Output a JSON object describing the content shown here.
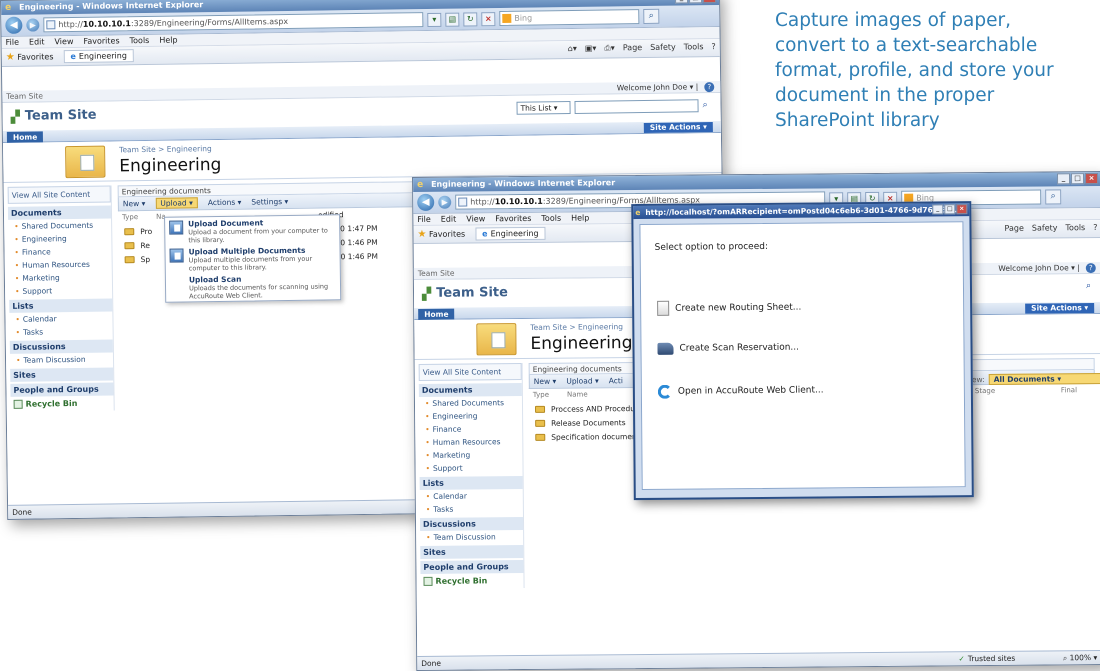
{
  "caption": {
    "lines": [
      "Capture images of paper,",
      "convert to a text-searchable",
      "format, profile, and store your",
      "document in the proper",
      "SharePoint library"
    ]
  },
  "browser": {
    "title": "Engineering - Windows Internet Explorer",
    "address_prefix": "http://",
    "address_host": "10.10.10.1",
    "address_rest": ":3289/Engineering/Forms/AllItems.aspx",
    "search_placeholder": "Bing",
    "menu": [
      "File",
      "Edit",
      "View",
      "Favorites",
      "Tools",
      "Help"
    ],
    "favorites_label": "Favorites",
    "tab_label": "Engineering",
    "cmd": [
      "Page",
      "Safety",
      "Tools"
    ],
    "status_left": "Done",
    "status_trusted": "Trusted sites",
    "status_zoom": "100%"
  },
  "sharepoint": {
    "top_label": "Team Site",
    "welcome": "Welcome John Doe",
    "site_title": "Team Site",
    "scope": "This List",
    "home_tab": "Home",
    "site_actions": "Site Actions",
    "breadcrumb": "Team Site > Engineering",
    "page_title": "Engineering",
    "view_all": "View All Site Content",
    "quick_launch": [
      {
        "header": "Documents",
        "items": [
          "Shared Documents",
          "Engineering",
          "Finance",
          "Human Resources",
          "Marketing",
          "Support"
        ]
      },
      {
        "header": "Lists",
        "items": [
          "Calendar",
          "Tasks"
        ]
      },
      {
        "header": "Discussions",
        "items": [
          "Team Discussion"
        ]
      },
      {
        "header": "Sites",
        "items": []
      },
      {
        "header": "People and Groups",
        "items": []
      }
    ],
    "recycle_bin": "Recycle Bin",
    "list_title": "Engineering documents",
    "toolbar": {
      "new": "New",
      "upload": "Upload",
      "actions": "Actions",
      "settings": "Settings"
    },
    "col_type": "Type",
    "col_name": "Name",
    "col_modified": "odified",
    "col_stage": "Stage",
    "col_final": "Final",
    "view_label": "View:",
    "view_value": "All Documents",
    "rows_front": [
      "Proccess AND Procedur",
      "Release Documents",
      "Specification document"
    ],
    "rows_back": [
      "Pro",
      "Re",
      "Sp"
    ],
    "rows_modified": [
      "/26/2010 1:47 PM",
      "/26/2010 1:46 PM",
      "/26/2010 1:46 PM"
    ]
  },
  "upload_menu": [
    {
      "title": "Upload Document",
      "desc": "Upload a document from your computer to this library."
    },
    {
      "title": "Upload Multiple Documents",
      "desc": "Upload multiple documents from your computer to this library."
    },
    {
      "title": "Upload Scan",
      "desc": "Uploads the documents for scanning using AccuRoute Web Client."
    }
  ],
  "modal": {
    "title": "http://localhost/?omARRecipient=omPostd04c6eb6-3d01-4766-9d76-78a...",
    "prompt": "Select option to proceed:",
    "options": [
      {
        "label": "Create new Routing Sheet...",
        "icon": "routing-sheet-icon"
      },
      {
        "label": "Create Scan Reservation...",
        "icon": "scanner-icon"
      },
      {
        "label": "Open in AccuRoute Web Client...",
        "icon": "accuroute-icon"
      }
    ]
  }
}
